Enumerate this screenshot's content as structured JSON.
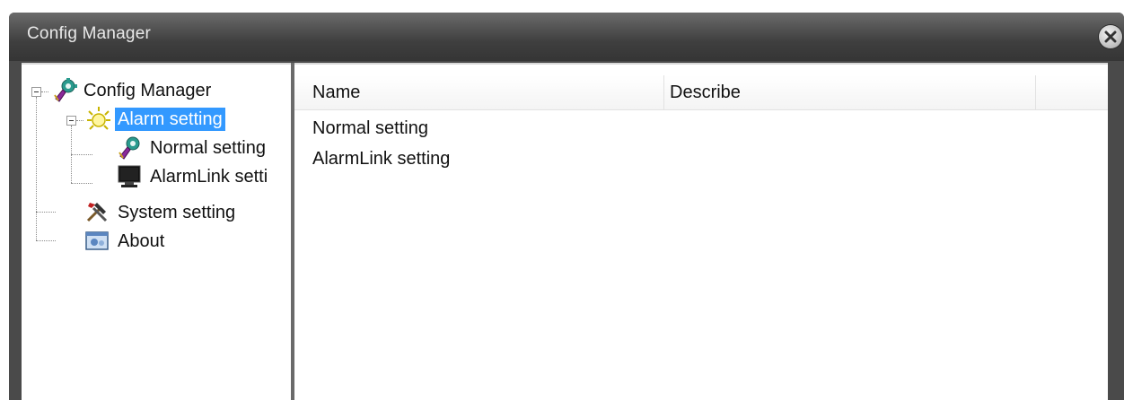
{
  "window": {
    "title": "Config Manager",
    "close_icon": "close-icon"
  },
  "tree": {
    "root": {
      "label": "Config Manager",
      "icon": "config-gear-icon",
      "expanded": true
    },
    "alarm": {
      "label": "Alarm setting",
      "icon": "alarm-light-icon",
      "expanded": true,
      "selected": true
    },
    "normal": {
      "label": "Normal setting",
      "icon": "config-gear-icon"
    },
    "alarmlink": {
      "label": "AlarmLink setti",
      "icon": "monitor-icon"
    },
    "system": {
      "label": "System setting",
      "icon": "tools-icon"
    },
    "about": {
      "label": "About",
      "icon": "about-window-icon"
    }
  },
  "list": {
    "columns": [
      "Name",
      "Describe"
    ],
    "rows": [
      {
        "name": "Normal setting",
        "describe": ""
      },
      {
        "name": "AlarmLink setting",
        "describe": ""
      }
    ]
  },
  "colors": {
    "titlebar": "#3f3f3f",
    "selection": "#3399ff"
  }
}
